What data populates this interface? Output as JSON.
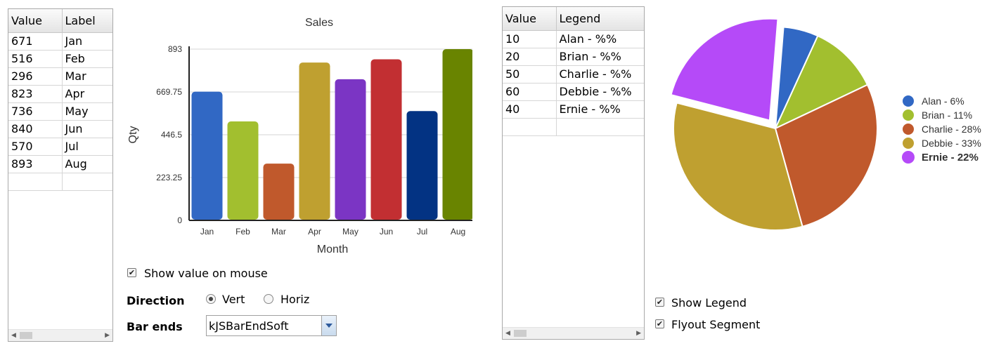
{
  "left_grid": {
    "headers": [
      "Value",
      "Label"
    ],
    "rows": [
      [
        "671",
        "Jan"
      ],
      [
        "516",
        "Feb"
      ],
      [
        "296",
        "Mar"
      ],
      [
        "823",
        "Apr"
      ],
      [
        "736",
        "May"
      ],
      [
        "840",
        "Jun"
      ],
      [
        "570",
        "Jul"
      ],
      [
        "893",
        "Aug"
      ]
    ]
  },
  "right_grid": {
    "headers": [
      "Value",
      "Legend"
    ],
    "rows": [
      [
        "10",
        "Alan - %%"
      ],
      [
        "20",
        "Brian - %%"
      ],
      [
        "50",
        "Charlie - %%"
      ],
      [
        "60",
        "Debbie - %%"
      ],
      [
        "40",
        "Ernie - %%"
      ]
    ]
  },
  "bar_controls": {
    "show_value_label": "Show value on mouse",
    "show_value_checked": true,
    "direction_label": "Direction",
    "direction_options": [
      "Vert",
      "Horiz"
    ],
    "direction_selected": "Vert",
    "bar_ends_label": "Bar ends",
    "bar_ends_value": "kJSBarEndSoft"
  },
  "pie_controls": {
    "show_legend_label": "Show Legend",
    "show_legend_checked": true,
    "flyout_label": "Flyout Segment",
    "flyout_checked": true
  },
  "chart_data": [
    {
      "type": "bar",
      "title": "Sales",
      "xlabel": "Month",
      "ylabel": "Qty",
      "categories": [
        "Jan",
        "Feb",
        "Mar",
        "Apr",
        "May",
        "Jun",
        "Jul",
        "Aug"
      ],
      "values": [
        671,
        516,
        296,
        823,
        736,
        840,
        570,
        893
      ],
      "colors": [
        "#3168c4",
        "#a2bf2f",
        "#c0592c",
        "#bfa030",
        "#7b35c4",
        "#c22f32",
        "#033383",
        "#698400"
      ],
      "ylim": [
        0,
        893
      ],
      "yticks": [
        "0",
        "223.25",
        "446.5",
        "669.75",
        "893"
      ],
      "grid": true
    },
    {
      "type": "pie",
      "labels": [
        "Alan - 6%",
        "Brian - 11%",
        "Charlie - 28%",
        "Debbie - 33%",
        "Ernie - 22%"
      ],
      "values": [
        10,
        20,
        50,
        60,
        40
      ],
      "colors": [
        "#3168c4",
        "#a2bf2f",
        "#c0592c",
        "#bfa030",
        "#b54af8"
      ],
      "exploded": "Ernie - 22%",
      "legend_position": "right"
    }
  ]
}
